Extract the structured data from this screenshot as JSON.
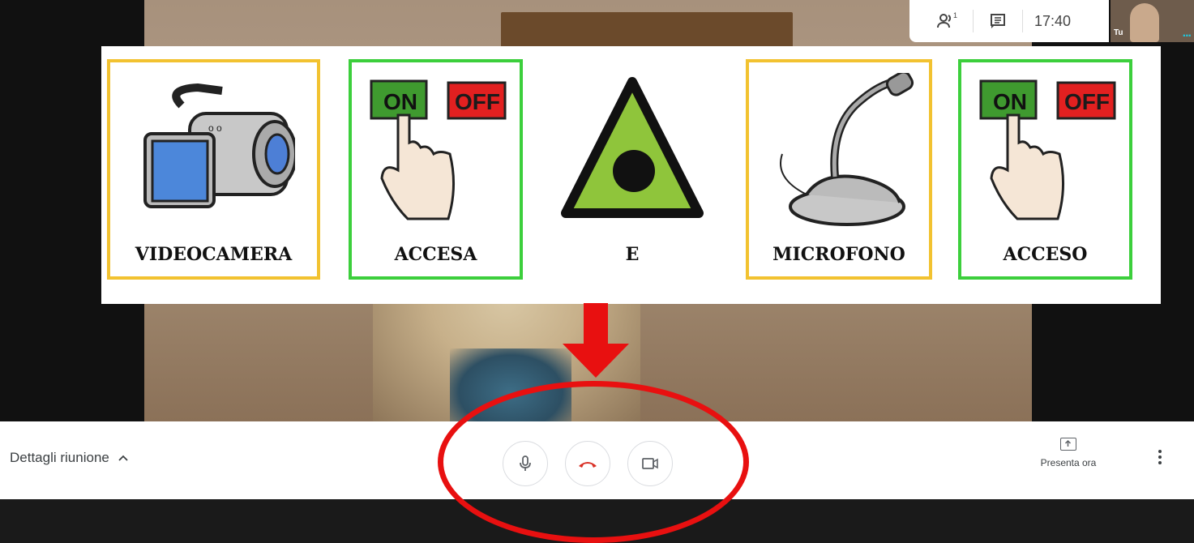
{
  "topbar": {
    "participants_icon": "people-icon",
    "participant_count": "1",
    "chat_icon": "chat-icon",
    "time": "17:40",
    "self_label": "Tu",
    "self_more": "..."
  },
  "panel": {
    "cards": [
      {
        "label": "VIDEOCAMERA",
        "border": "#f2c230",
        "icon": "videocamera-icon"
      },
      {
        "label": "ACCESA",
        "border": "#3ccf3c",
        "icon": "on-off-icon"
      },
      {
        "label": "E",
        "border": "none",
        "icon": "triangle-icon"
      },
      {
        "label": "MICROFONO",
        "border": "#f2c230",
        "icon": "microphone-icon"
      },
      {
        "label": "ACCESO",
        "border": "#3ccf3c",
        "icon": "on-off-icon"
      }
    ],
    "on_text": "ON",
    "off_text": "OFF"
  },
  "annotations": {
    "arrow_color": "#e81010",
    "ellipse_color": "#e81010"
  },
  "bottom": {
    "details_label": "Dettagli riunione",
    "mic_icon": "microphone-icon",
    "hangup_icon": "hang-up-icon",
    "camera_icon": "camera-icon",
    "present_label": "Presenta ora",
    "more_icon": "more-vert-icon"
  }
}
